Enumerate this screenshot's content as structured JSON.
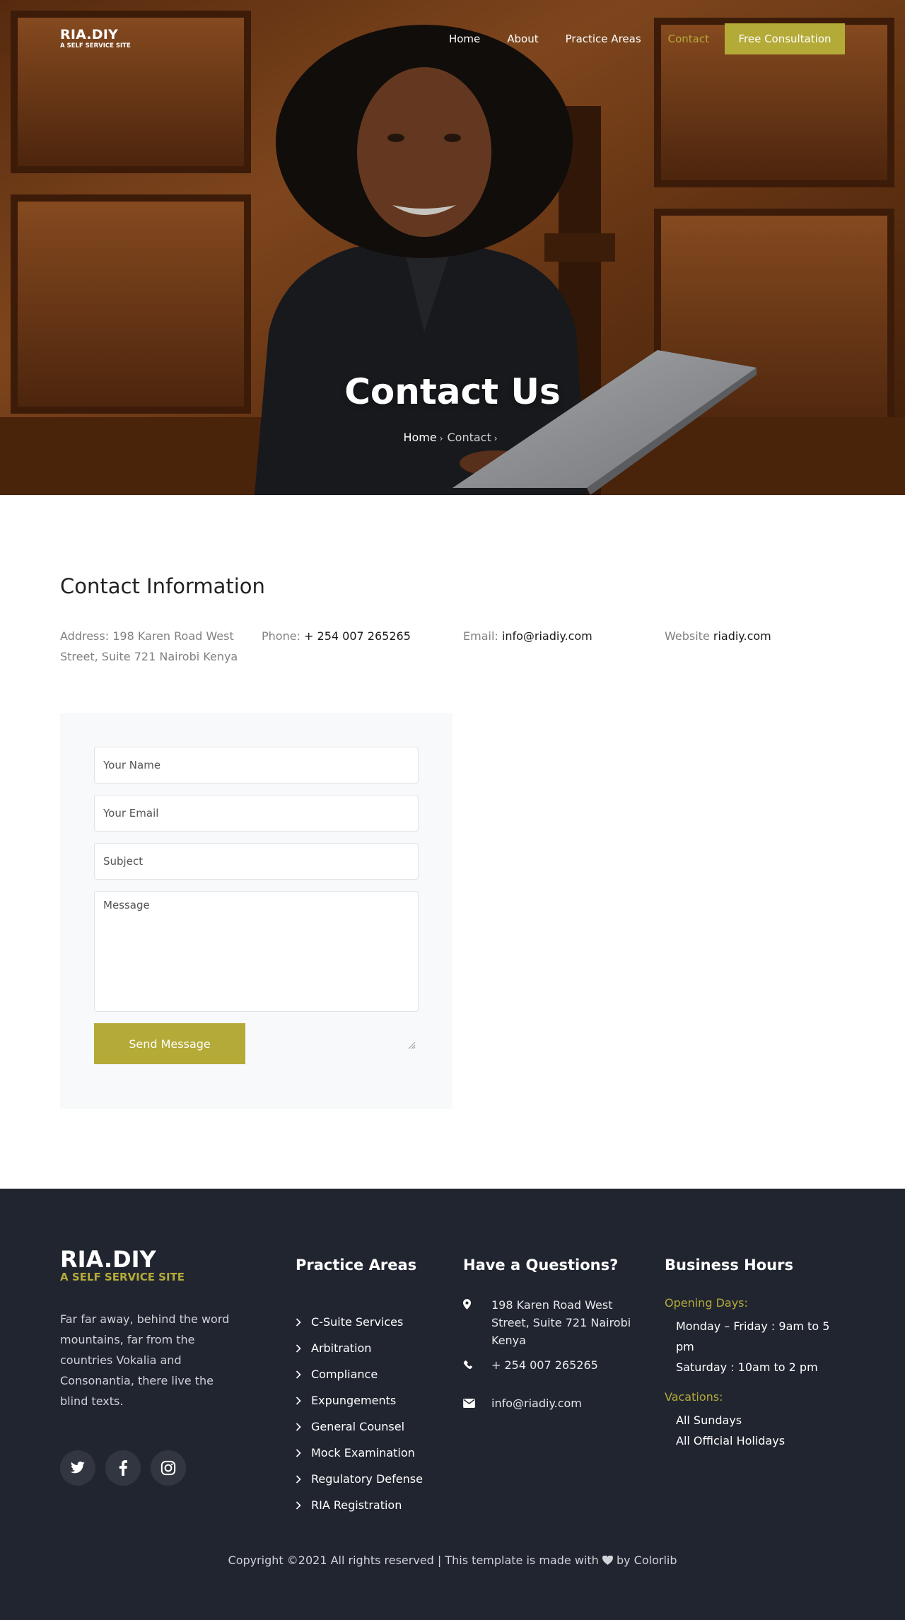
{
  "nav": {
    "brand_title": "RIA.DIY",
    "brand_subtitle": "A SELF SERVICE SITE",
    "links": [
      {
        "label": "Home",
        "active": false
      },
      {
        "label": "About",
        "active": false
      },
      {
        "label": "Practice Areas",
        "active": false
      },
      {
        "label": "Contact",
        "active": true
      }
    ],
    "cta_label": "Free Consultation"
  },
  "hero": {
    "title": "Contact Us",
    "breadcrumb": [
      "Home",
      "Contact"
    ]
  },
  "contact": {
    "heading": "Contact Information",
    "address": {
      "label": "Address:",
      "line1": "198 Karen Road West",
      "line2": "Street, Suite 721 Nairobi Kenya"
    },
    "phone": {
      "label": "Phone:",
      "value": "+ 254 007 265265"
    },
    "email": {
      "label": "Email:",
      "value": "info@riadiy.com"
    },
    "website": {
      "label": "Website",
      "value": "riadiy.com"
    }
  },
  "form": {
    "name_placeholder": "Your Name",
    "email_placeholder": "Your Email",
    "subject_placeholder": "Subject",
    "message_placeholder": "Message",
    "submit_label": "Send Message"
  },
  "footer": {
    "brand_title": "RIA.DIY",
    "brand_subtitle": "A SELF SERVICE SITE",
    "about": "Far far away, behind the word mountains, far from the countries Vokalia and Consonantia, there live the blind texts.",
    "socials": [
      "twitter-icon",
      "facebook-icon",
      "instagram-icon"
    ],
    "practice_heading": "Practice Areas",
    "practice_areas": [
      "C-Suite Services",
      "Arbitration",
      "Compliance",
      "Expungements",
      "General Counsel",
      "Mock Examination",
      "Regulatory Defense",
      "RIA Registration"
    ],
    "questions_heading": "Have a Questions?",
    "address": "198 Karen Road West Street, Suite 721 Nairobi Kenya",
    "phone": "+ 254 007 265265",
    "email": "info@riadiy.com",
    "hours_heading": "Business Hours",
    "opening_label": "Opening Days:",
    "opening_lines": [
      "Monday – Friday : 9am to 5 pm",
      "Saturday : 10am to 2 pm"
    ],
    "vacations_label": "Vacations:",
    "vacation_lines": [
      "All Sundays",
      "All Official Holidays"
    ],
    "copyright": "Copyright ©2021 All rights reserved | This template is made with",
    "copyright_by": "by Colorlib"
  },
  "colors": {
    "accent": "#b4aa38",
    "footer_bg": "#212530",
    "form_bg": "#f8f9fa"
  }
}
